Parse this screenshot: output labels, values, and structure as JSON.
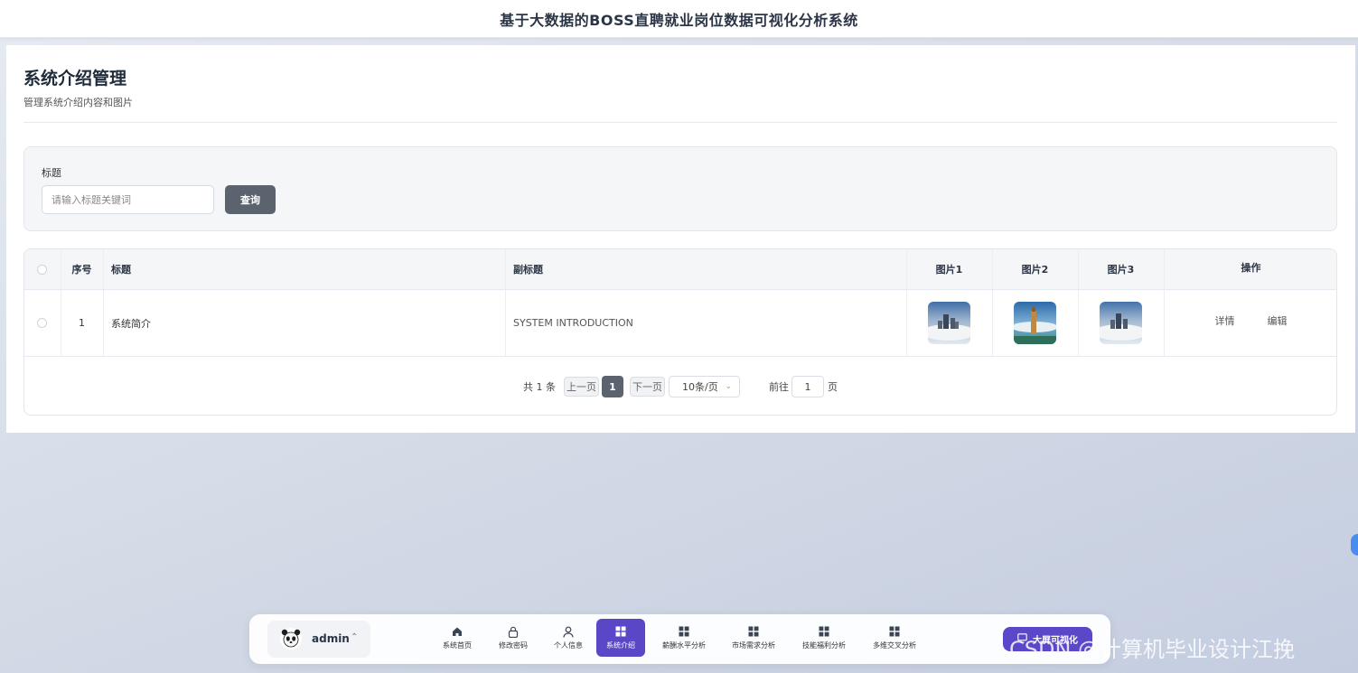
{
  "app": {
    "title": "基于大数据的BOSS直聘就业岗位数据可视化分析系统"
  },
  "page": {
    "title": "系统介绍管理",
    "subtitle": "管理系统介绍内容和图片"
  },
  "search": {
    "label": "标题",
    "placeholder": "请输入标题关键词",
    "value": "",
    "button_label": "查询"
  },
  "table": {
    "columns": {
      "index": "序号",
      "title": "标题",
      "subtitle": "副标题",
      "image1": "图片1",
      "image2": "图片2",
      "image3": "图片3",
      "actions": "操作"
    },
    "rows": [
      {
        "index": "1",
        "title": "系统简介",
        "subtitle": "SYSTEM INTRODUCTION",
        "actions": {
          "detail": "详情",
          "edit": "编辑"
        }
      }
    ]
  },
  "pagination": {
    "total_text": "共 1 条",
    "prev_label": "上一页",
    "current_page": "1",
    "next_label": "下一页",
    "page_size": "10条/页",
    "goto_label": "前往",
    "goto_value": "1",
    "page_unit": "页"
  },
  "dock": {
    "user": {
      "name": "admin"
    },
    "nav": [
      {
        "label": "系统首页",
        "icon": "home-icon",
        "active": false
      },
      {
        "label": "修改密码",
        "icon": "lock-icon",
        "active": false
      },
      {
        "label": "个人信息",
        "icon": "user-icon",
        "active": false
      },
      {
        "label": "系统介绍",
        "icon": "grid-icon",
        "active": true
      },
      {
        "label": "薪酬水平分析",
        "icon": "grid-icon",
        "active": false
      },
      {
        "label": "市场需求分析",
        "icon": "grid-icon",
        "active": false
      },
      {
        "label": "技能福利分析",
        "icon": "grid-icon",
        "active": false
      },
      {
        "label": "多维交叉分析",
        "icon": "grid-icon",
        "active": false
      }
    ],
    "cta_label": "大屏可视化"
  },
  "watermark": "CSDN @计算机毕业设计江挽",
  "colors": {
    "primary": "#5a47c8",
    "button": "#5b636e",
    "link_text": "#555555"
  }
}
